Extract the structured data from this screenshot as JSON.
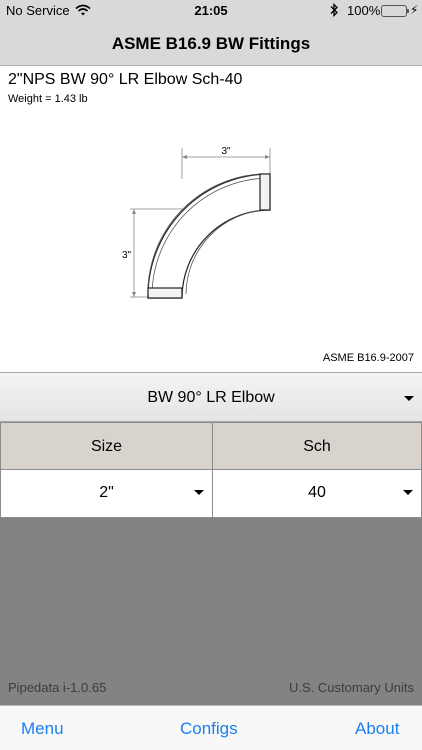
{
  "status_bar": {
    "carrier": "No Service",
    "wifi_icon": "wifi-icon",
    "time": "21:05",
    "bluetooth_icon": "bluetooth-icon",
    "battery_percent": "100%",
    "battery_level": 1.0,
    "battery_color": "#3cc23c"
  },
  "nav": {
    "title": "ASME B16.9 BW Fittings"
  },
  "detail": {
    "heading": "2\"NPS BW 90° LR Elbow Sch-40",
    "weight": "Weight = 1.43 lb",
    "dimension_top": "3\"",
    "dimension_side": "3\"",
    "standard": "ASME B16.9-2007"
  },
  "fitting_selector": {
    "value": "BW 90° LR Elbow"
  },
  "table": {
    "headers": [
      "Size",
      "Sch"
    ],
    "values": [
      "2\"",
      "40"
    ]
  },
  "footer_info": {
    "version": "Pipedata i-1.0.65",
    "units": "U.S. Customary Units"
  },
  "tabs": {
    "menu": "Menu",
    "configs": "Configs",
    "about": "About"
  },
  "colors": {
    "accent": "#1a7ff0",
    "bar_background": "#d9d9d9",
    "gray_area": "#838383",
    "table_header": "#d8d4cd"
  }
}
